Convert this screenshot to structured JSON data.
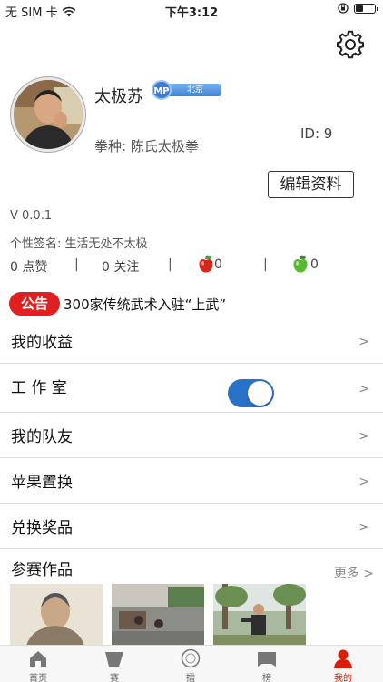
{
  "status_bar": {
    "carrier": "无 SIM 卡",
    "time": "下午3:12",
    "battery_level": 0.4
  },
  "profile": {
    "name": "太极苏",
    "badge_label": "MP",
    "location": "北京",
    "style_label": "拳种:",
    "style_value": "陈氏太极拳",
    "id_text": "ID: 9",
    "edit_label": "编辑资料"
  },
  "info": {
    "version": "V 0.0.1",
    "signature_label": "个性签名:",
    "signature_value": "生活无处不太极"
  },
  "stats": {
    "likes": "0 点赞",
    "follows": "0 关注",
    "red_apples": "0",
    "green_apples": "0",
    "separator": "|"
  },
  "notice": {
    "tag": "公告",
    "text": "300家传统武术入驻“上武”"
  },
  "menu": [
    {
      "label": "我的收益",
      "arrow": ">"
    },
    {
      "label": "工 作 室",
      "arrow": ">",
      "toggle_on": true
    },
    {
      "label": "我的队友",
      "arrow": ">"
    },
    {
      "label": "苹果置换",
      "arrow": ">"
    },
    {
      "label": "兑换奖品",
      "arrow": ">"
    }
  ],
  "works": {
    "title": "参赛作品",
    "more": "更多 >"
  },
  "tabs": [
    {
      "label": "首页",
      "icon": "home-icon"
    },
    {
      "label": "赛",
      "icon": "flag-icon"
    },
    {
      "label": "擂",
      "icon": "ring-icon"
    },
    {
      "label": "榜",
      "icon": "banner-icon"
    },
    {
      "label": "我的",
      "icon": "person-icon",
      "active": true
    }
  ],
  "colors": {
    "accent_red": "#e02020",
    "toggle_blue": "#2a72c7",
    "badge_blue": "#3a7bd5"
  }
}
